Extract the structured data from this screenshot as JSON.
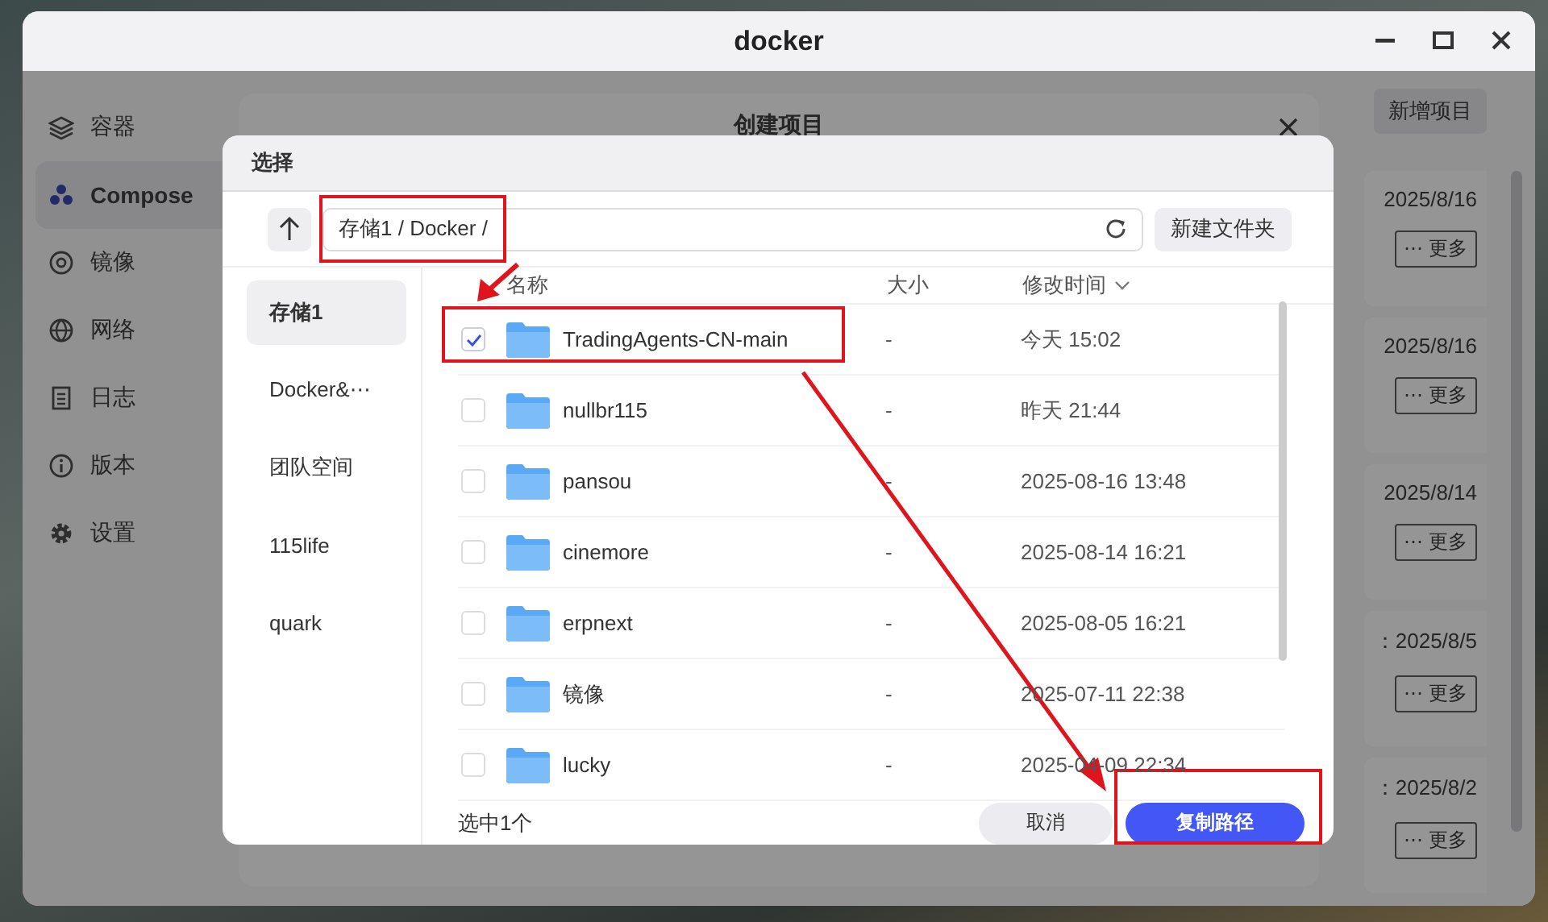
{
  "window": {
    "title": "docker"
  },
  "sidebar": {
    "items": [
      {
        "label": "容器",
        "selected": false
      },
      {
        "label": "Compose",
        "selected": true
      },
      {
        "label": "镜像",
        "selected": false
      },
      {
        "label": "网络",
        "selected": false
      },
      {
        "label": "日志",
        "selected": false
      },
      {
        "label": "版本",
        "selected": false
      },
      {
        "label": "设置",
        "selected": false
      }
    ]
  },
  "main": {
    "new_button": "新增项目",
    "cards": [
      {
        "date": "2025/8/16",
        "more": "⋯ 更多"
      },
      {
        "date": "2025/8/16",
        "more": "⋯ 更多"
      },
      {
        "date": "2025/8/14",
        "more": "⋯ 更多"
      },
      {
        "date": "：2025/8/5",
        "more": "⋯ 更多"
      },
      {
        "date": "：2025/8/2",
        "more": "⋯ 更多"
      }
    ]
  },
  "create_dialog": {
    "title": "创建项目"
  },
  "picker": {
    "title": "选择",
    "path": "存储1 / Docker /",
    "path_annotated": true,
    "new_folder": "新建文件夹",
    "locations": [
      {
        "label": "存储1",
        "selected": true
      },
      {
        "label": "Docker&⋯",
        "selected": false
      },
      {
        "label": "团队空间",
        "selected": false
      },
      {
        "label": "115life",
        "selected": false
      },
      {
        "label": "quark",
        "selected": false
      }
    ],
    "columns": [
      {
        "label": "名称",
        "sorted": false
      },
      {
        "label": "大小",
        "sorted": false
      },
      {
        "label": "修改时间",
        "sorted": true
      }
    ],
    "rows": [
      {
        "name": "TradingAgents-CN-main",
        "size": "-",
        "modified": "今天 15:02",
        "checked": true,
        "annotated": true
      },
      {
        "name": "nullbr115",
        "size": "-",
        "modified": "昨天 21:44",
        "checked": false,
        "annotated": false
      },
      {
        "name": "pansou",
        "size": "-",
        "modified": "2025-08-16 13:48",
        "checked": false,
        "annotated": false
      },
      {
        "name": "cinemore",
        "size": "-",
        "modified": "2025-08-14 16:21",
        "checked": false,
        "annotated": false
      },
      {
        "name": "erpnext",
        "size": "-",
        "modified": "2025-08-05 16:21",
        "checked": false,
        "annotated": false
      },
      {
        "name": "镜像",
        "size": "-",
        "modified": "2025-07-11 22:38",
        "checked": false,
        "annotated": false
      },
      {
        "name": "lucky",
        "size": "-",
        "modified": "2025-04-09 22:34",
        "checked": false,
        "annotated": false
      }
    ],
    "selection_count": "选中1个",
    "cancel": "取消",
    "confirm": "复制路径",
    "confirm_annotated": true
  }
}
